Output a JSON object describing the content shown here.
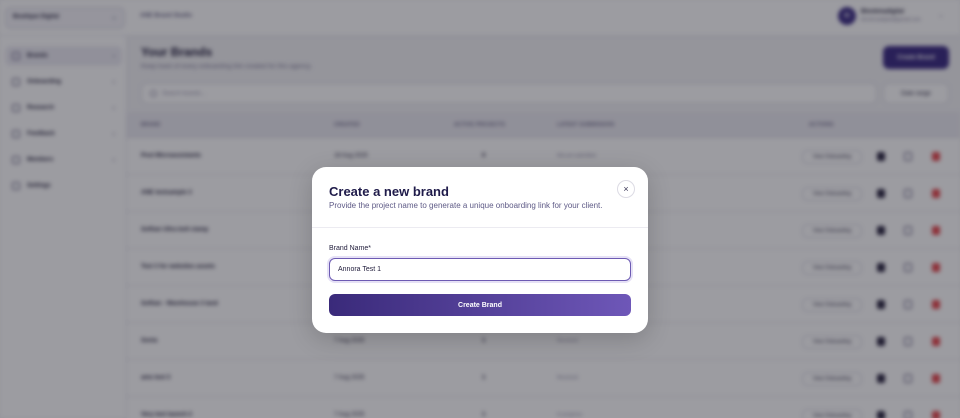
{
  "app": {
    "workspace": "Boutique Digital",
    "title": "ANE Brand Studio",
    "user_initials": "BI",
    "user_name": "Blookmadigital",
    "user_email": "blookmadigital@gmail.com"
  },
  "sidebar": {
    "items": [
      {
        "label": "Brands",
        "active": true
      },
      {
        "label": "Onboarding",
        "active": false
      },
      {
        "label": "Research",
        "active": false
      },
      {
        "label": "Feedback",
        "active": false
      },
      {
        "label": "Members",
        "active": false
      },
      {
        "label": "Settings",
        "active": false
      }
    ]
  },
  "page": {
    "title": "Your Brands",
    "subtitle": "Keep track of every onboarding link created for this agency.",
    "create_label": "Create Brand",
    "search_placeholder": "Search brands...",
    "range_label": "Date range"
  },
  "table": {
    "headers": [
      "BRAND",
      "CREATED",
      "ACTIVE PROJECTS",
      "LATEST SUBMISSION",
      "ACTIONS"
    ],
    "view_label": "View Onboarding",
    "rows": [
      {
        "brand": "Post Microassistants",
        "created": "18 Aug 2025",
        "projects": "0",
        "latest": "Not yet submitted"
      },
      {
        "brand": "ANE testsample 3",
        "created": "",
        "projects": "",
        "latest": ""
      },
      {
        "brand": "Softian Ultra bolt clamp",
        "created": "",
        "projects": "",
        "latest": ""
      },
      {
        "brand": "Test 3 for websites assets",
        "created": "",
        "projects": "",
        "latest": ""
      },
      {
        "brand": "Softian - Warehouse 3 land",
        "created": "",
        "projects": "",
        "latest": ""
      },
      {
        "brand": "Sonia",
        "created": "7 Aug 2025",
        "projects": "1",
        "latest": "Received"
      },
      {
        "brand": "ams test 3",
        "created": "7 Aug 2025",
        "projects": "1",
        "latest": "Received"
      },
      {
        "brand": "Very test launch 2",
        "created": "7 Aug 2025",
        "projects": "1",
        "latest": "In progress"
      }
    ]
  },
  "modal": {
    "title": "Create a new brand",
    "subtitle": "Provide the project name to generate a unique onboarding link for your client.",
    "field_label": "Brand Name*",
    "field_value": "Annora Test 1",
    "submit_label": "Create Brand",
    "close_glyph": "×"
  },
  "colors": {
    "accent": "#3a2a82",
    "accent_light": "#6e57b8",
    "delete": "#e5484d"
  },
  "icons": {
    "close": "close-icon",
    "search": "search-icon",
    "eye": "eye-icon",
    "edit": "edit-icon",
    "trash": "trash-icon"
  }
}
